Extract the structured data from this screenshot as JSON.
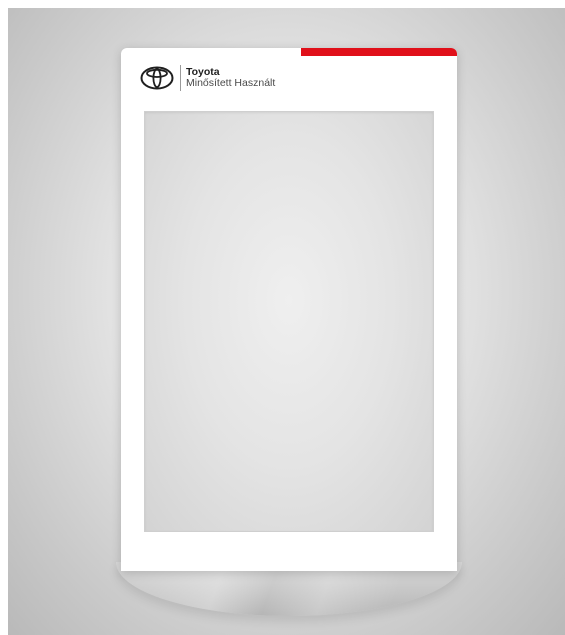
{
  "brand": {
    "name": "Toyota",
    "subtitle": "Minősített Használt",
    "emblem_icon": "toyota-emblem-icon"
  },
  "colors": {
    "accent": "#e0101a",
    "card": "#ffffff",
    "photo_slot": "#e6e6e6"
  }
}
